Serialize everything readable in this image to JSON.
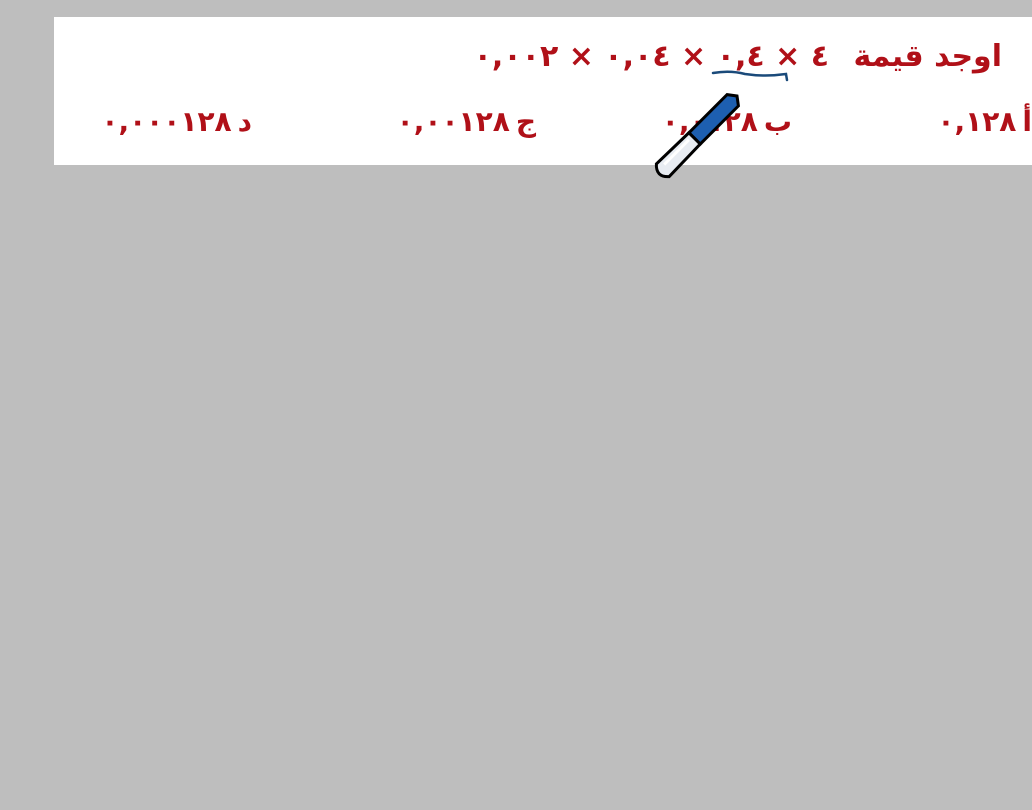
{
  "question": {
    "prompt": "اوجد قيمة",
    "expression": "٤ × ٠,٤ × ٠,٠٤ × ٠,٠٠٢"
  },
  "options": [
    {
      "letter": "أ",
      "value": "٠,١٢٨"
    },
    {
      "letter": "ب",
      "value": "٠,٠١٢٨"
    },
    {
      "letter": "ج",
      "value": "٠,٠٠١٢٨"
    },
    {
      "letter": "د",
      "value": "٠,٠٠٠١٢٨"
    }
  ],
  "colors": {
    "text": "#b01018",
    "background": "#bebebe",
    "ink": "#1a4a7a",
    "pen": "#1d5fb0"
  },
  "cursor": "pen-icon"
}
